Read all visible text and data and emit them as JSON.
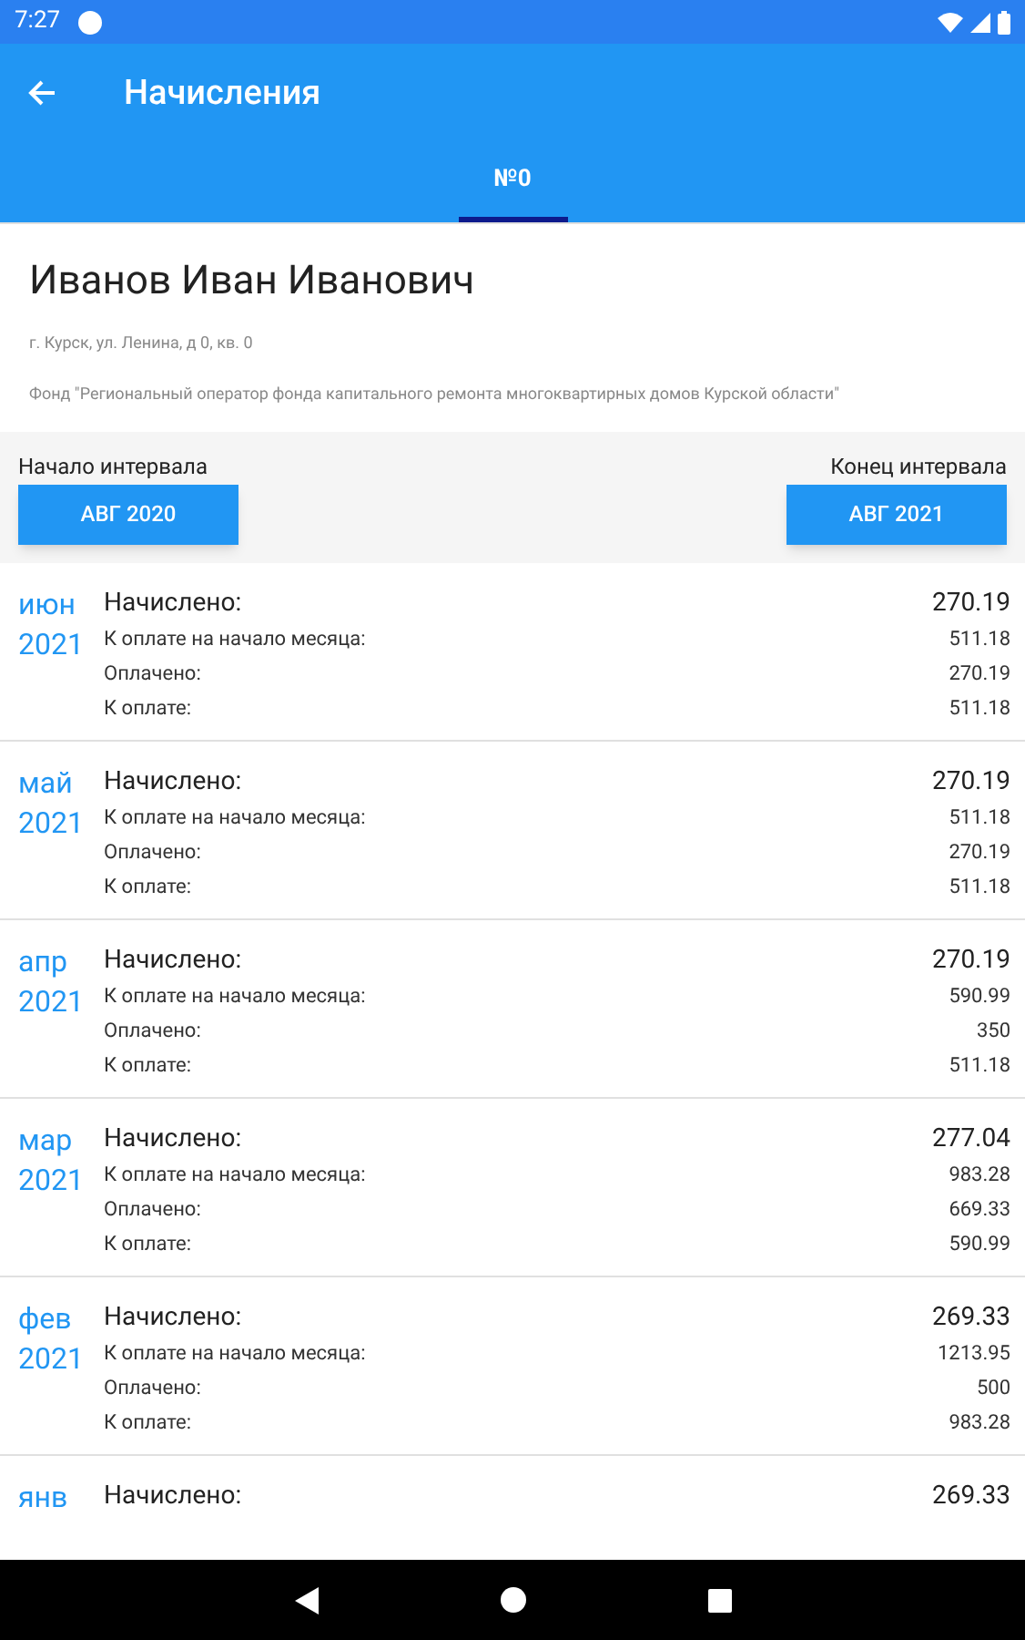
{
  "status_bar": {
    "time": "7:27"
  },
  "app_bar": {
    "title": "Начисления"
  },
  "tabs": [
    {
      "label": "№0",
      "selected": true
    }
  ],
  "account": {
    "name": "Иванов Иван Иванович",
    "address": "г. Курск, ул. Ленина, д 0, кв. 0",
    "fund": "Фонд \"Региональный оператор фонда капитального ремонта многоквартирных домов Курской области\""
  },
  "interval": {
    "start_label": "Начало интервала",
    "start_value": "АВГ 2020",
    "end_label": "Конец интервала",
    "end_value": "АВГ 2021"
  },
  "rows": [
    {
      "month": "июн",
      "year": "2021",
      "lines": [
        {
          "label": "Начислено:",
          "value": "270.19"
        },
        {
          "label": "К оплате на начало месяца:",
          "value": "511.18"
        },
        {
          "label": "Оплачено:",
          "value": "270.19"
        },
        {
          "label": "К оплате:",
          "value": "511.18"
        }
      ]
    },
    {
      "month": "май",
      "year": "2021",
      "lines": [
        {
          "label": "Начислено:",
          "value": "270.19"
        },
        {
          "label": "К оплате на начало месяца:",
          "value": "511.18"
        },
        {
          "label": "Оплачено:",
          "value": "270.19"
        },
        {
          "label": "К оплате:",
          "value": "511.18"
        }
      ]
    },
    {
      "month": "апр",
      "year": "2021",
      "lines": [
        {
          "label": "Начислено:",
          "value": "270.19"
        },
        {
          "label": "К оплате на начало месяца:",
          "value": "590.99"
        },
        {
          "label": "Оплачено:",
          "value": "350"
        },
        {
          "label": "К оплате:",
          "value": "511.18"
        }
      ]
    },
    {
      "month": "мар",
      "year": "2021",
      "lines": [
        {
          "label": "Начислено:",
          "value": "277.04"
        },
        {
          "label": "К оплате на начало месяца:",
          "value": "983.28"
        },
        {
          "label": "Оплачено:",
          "value": "669.33"
        },
        {
          "label": "К оплате:",
          "value": "590.99"
        }
      ]
    },
    {
      "month": "фев",
      "year": "2021",
      "lines": [
        {
          "label": "Начислено:",
          "value": "269.33"
        },
        {
          "label": "К оплате на начало месяца:",
          "value": "1213.95"
        },
        {
          "label": "Оплачено:",
          "value": "500"
        },
        {
          "label": "К оплате:",
          "value": "983.28"
        }
      ]
    },
    {
      "month": "янв",
      "lines": [
        {
          "label": "Начислено:",
          "value": "269.33"
        }
      ]
    }
  ]
}
